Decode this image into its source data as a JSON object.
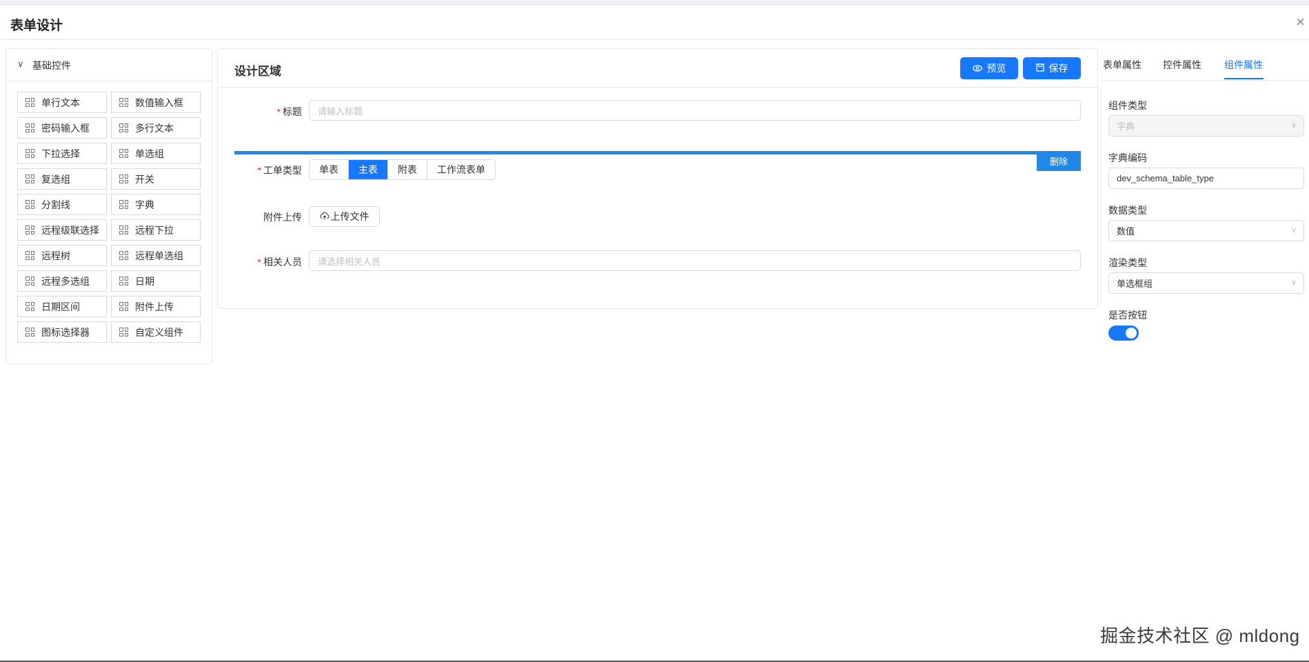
{
  "modal": {
    "title": "表单设计",
    "close": "×"
  },
  "left": {
    "section_title": "基础控件",
    "controls": [
      "单行文本",
      "数值输入框",
      "密码输入框",
      "多行文本",
      "下拉选择",
      "单选组",
      "复选组",
      "开关",
      "分割线",
      "字典",
      "远程级联选择",
      "远程下拉",
      "远程树",
      "远程单选组",
      "远程多选组",
      "日期",
      "日期区间",
      "附件上传",
      "图标选择器",
      "自定义组件"
    ]
  },
  "center": {
    "title": "设计区域",
    "preview_label": "预览",
    "save_label": "保存",
    "fields": {
      "title_label": "标题",
      "title_placeholder": "请输入标题",
      "type_label": "工单类型",
      "type_options": [
        "单表",
        "主表",
        "附表",
        "工作流表单"
      ],
      "type_selected": "主表",
      "delete_label": "删除",
      "attachment_label": "附件上传",
      "upload_label": "上传文件",
      "people_label": "相关人员",
      "people_placeholder": "请选择相关人员"
    }
  },
  "right": {
    "tabs": [
      "表单属性",
      "控件属性",
      "组件属性"
    ],
    "active_tab": "组件属性",
    "props": {
      "component_type_label": "组件类型",
      "component_type_value": "字典",
      "dict_code_label": "字典编码",
      "dict_code_value": "dev_schema_table_type",
      "data_type_label": "数据类型",
      "data_type_value": "数值",
      "render_type_label": "渲染类型",
      "render_type_value": "单选框组",
      "is_button_label": "是否按钮",
      "is_button_on": true
    }
  },
  "watermark": "掘金技术社区 @ mldong",
  "colors": {
    "primary": "#1677ff",
    "selection": "#1f88e8",
    "required": "#f5222d"
  }
}
